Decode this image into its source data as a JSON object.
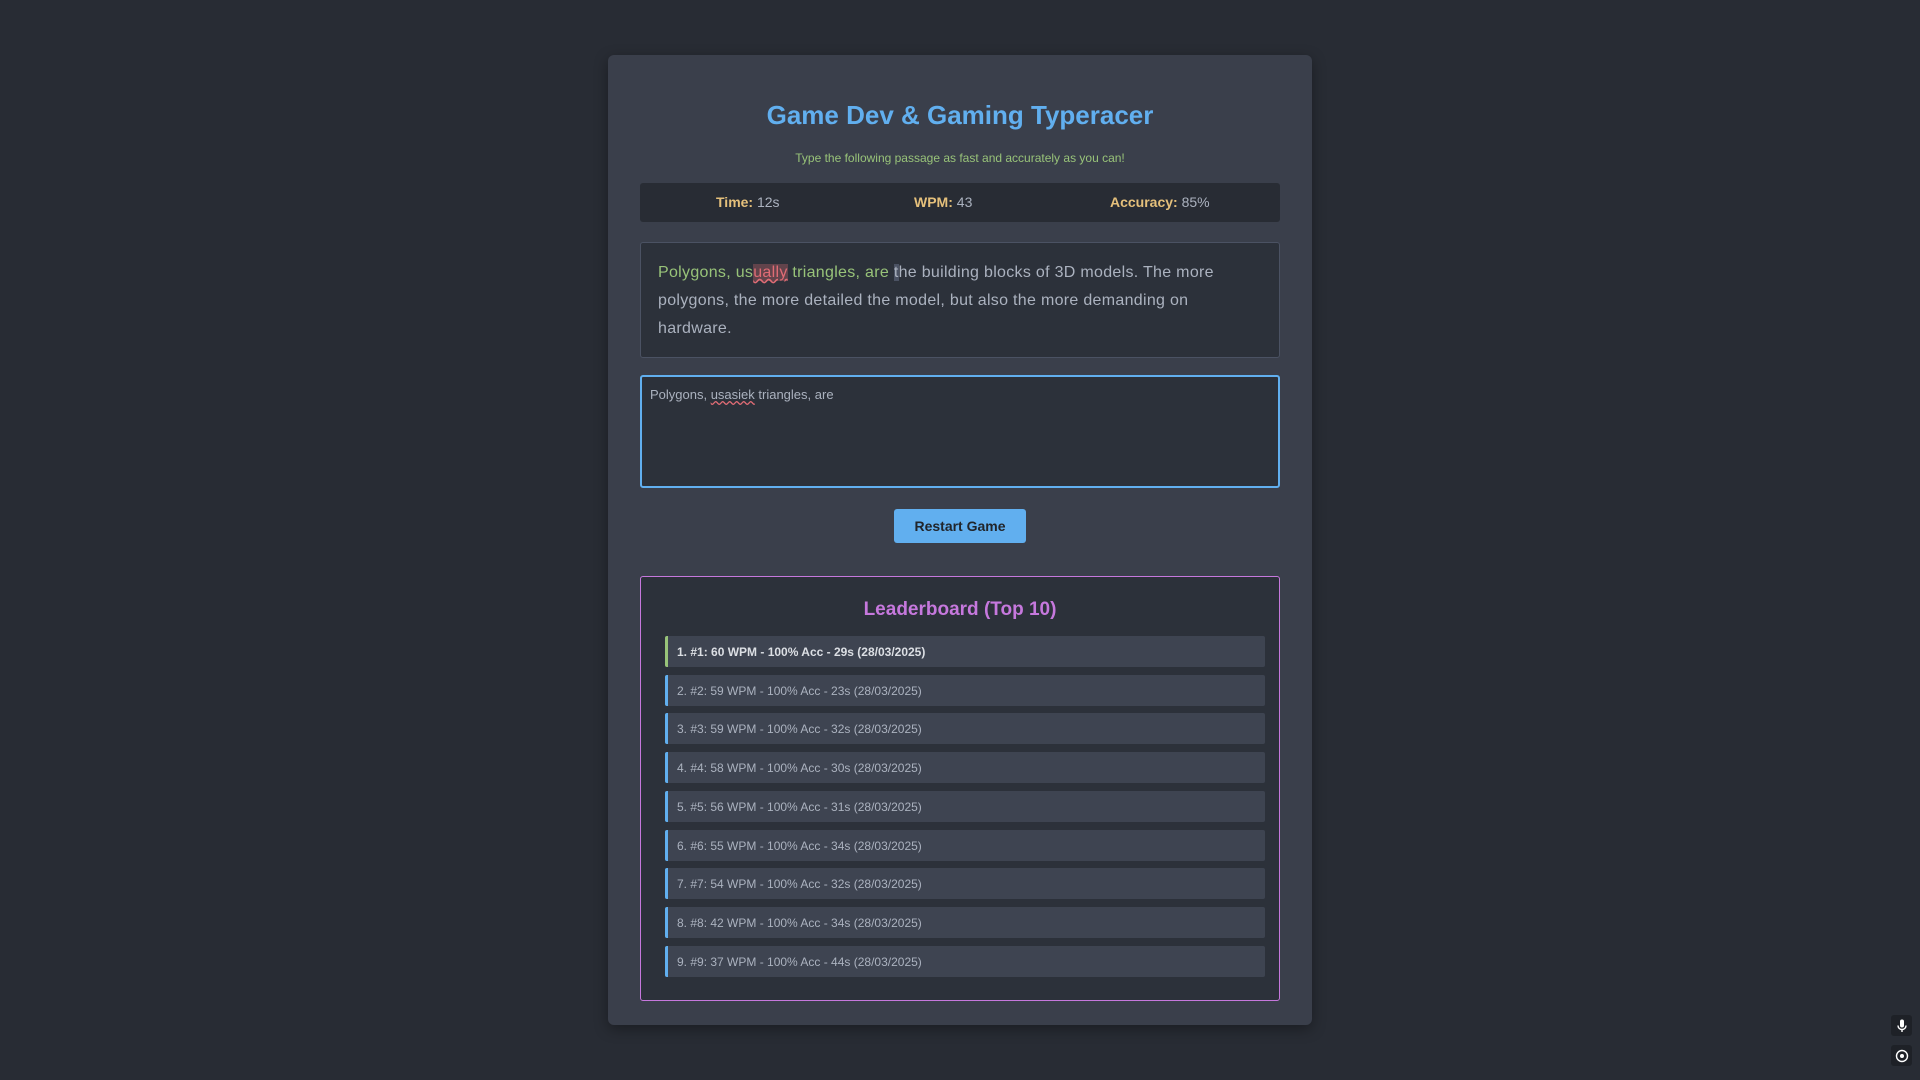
{
  "header": {
    "title": "Game Dev & Gaming Typeracer",
    "subtitle": "Type the following passage as fast and accurately as you can!"
  },
  "stats": {
    "time_label": "Time:",
    "time_value": "12s",
    "wpm_label": "WPM:",
    "wpm_value": "43",
    "accuracy_label": "Accuracy:",
    "accuracy_value": "85%"
  },
  "passage": {
    "typed_correct_1": "Polygons, us",
    "typed_error": "ually",
    "typed_correct_2": " triangles, are ",
    "cursor_char": "t",
    "remaining": "he building blocks of 3D models. The more polygons, the more detailed the model, but also the more demanding on hardware."
  },
  "input": {
    "text_before": "Polygons, ",
    "misspelled_word": "usasiek",
    "text_after": " triangles, are"
  },
  "controls": {
    "restart_label": "Restart Game"
  },
  "leaderboard": {
    "title": "Leaderboard (Top 10)",
    "entries": [
      "1. #1: 60 WPM - 100% Acc - 29s (28/03/2025)",
      "2. #2: 59 WPM - 100% Acc - 23s (28/03/2025)",
      "3. #3: 59 WPM - 100% Acc - 32s (28/03/2025)",
      "4. #4: 58 WPM - 100% Acc - 30s (28/03/2025)",
      "5. #5: 56 WPM - 100% Acc - 31s (28/03/2025)",
      "6. #6: 55 WPM - 100% Acc - 34s (28/03/2025)",
      "7. #7: 54 WPM - 100% Acc - 32s (28/03/2025)",
      "8. #8: 42 WPM - 100% Acc - 34s (28/03/2025)",
      "9. #9: 37 WPM - 100% Acc - 44s (28/03/2025)"
    ]
  },
  "corner": {
    "mic_icon": "microphone-icon",
    "settings_icon": "target-icon"
  }
}
